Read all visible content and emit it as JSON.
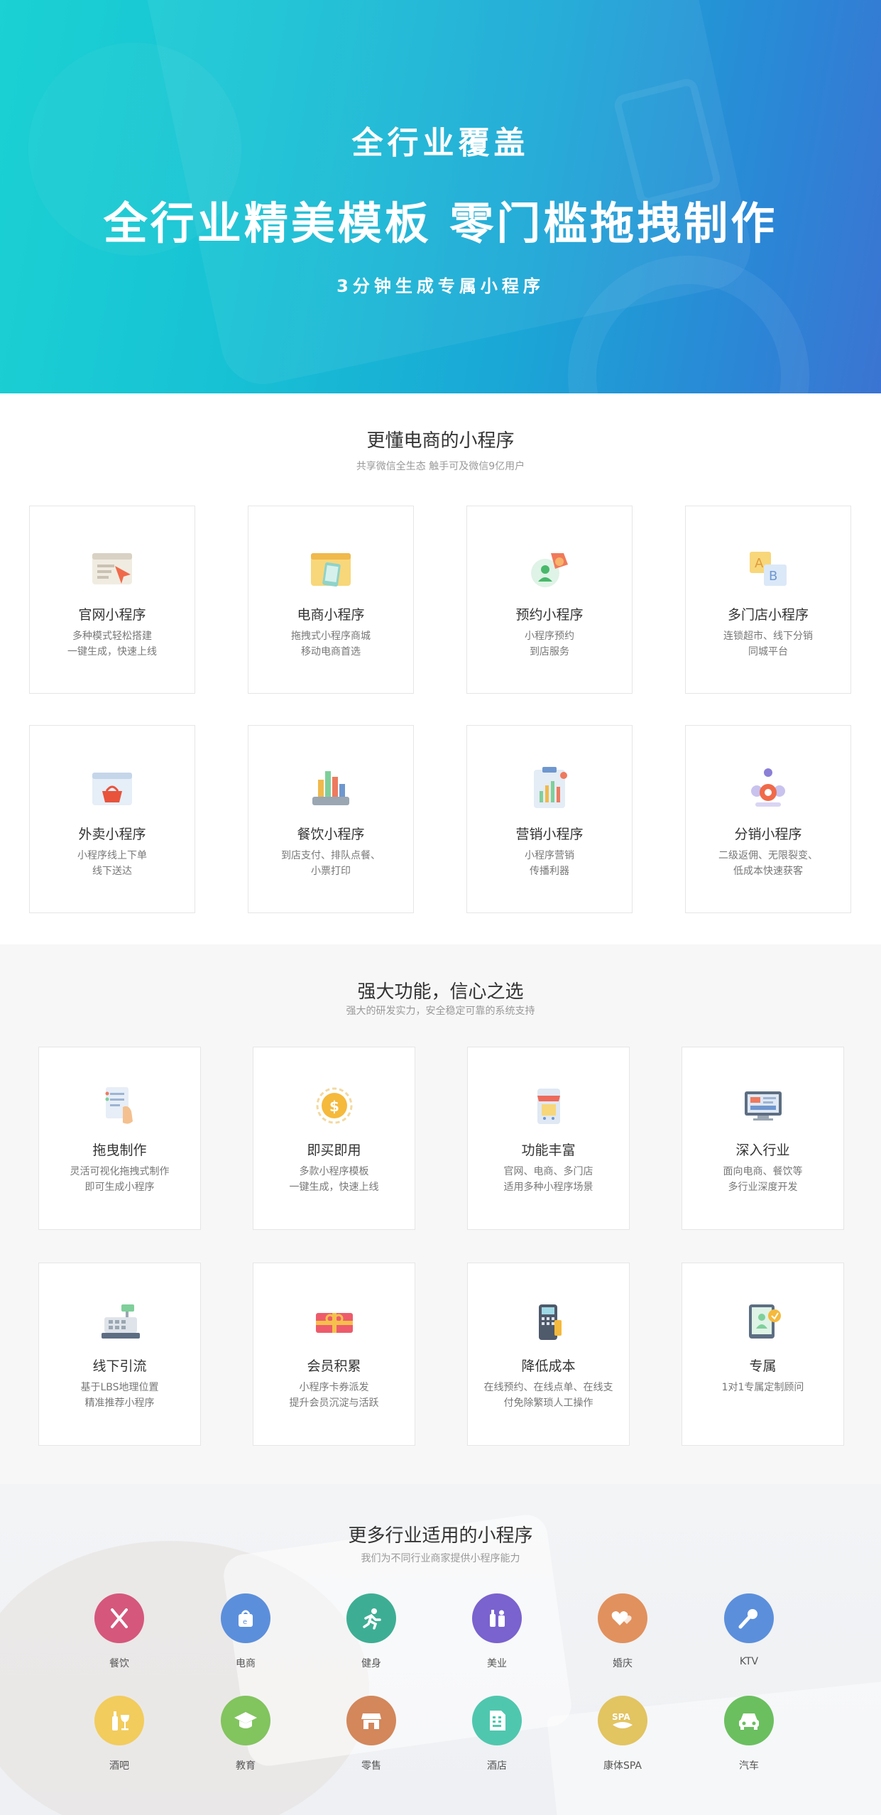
{
  "hero": {
    "subtitle_top": "全行业覆盖",
    "title": "全行业精美模板 零门槛拖拽制作",
    "subtitle_bottom": "3分钟生成专属小程序"
  },
  "section1": {
    "title": "更懂电商的小程序",
    "subtitle": "共享微信全生态 触手可及微信9亿用户",
    "cards": [
      {
        "icon": "website-icon",
        "title": "官网小程序",
        "desc": "多种模式轻松搭建\n一键生成，快速上线"
      },
      {
        "icon": "ecommerce-icon",
        "title": "电商小程序",
        "desc": "拖拽式小程序商城\n移动电商首选"
      },
      {
        "icon": "booking-icon",
        "title": "预约小程序",
        "desc": "小程序预约\n到店服务"
      },
      {
        "icon": "multi-store-icon",
        "title": "多门店小程序",
        "desc": "连锁超市、线下分销\n同城平台"
      },
      {
        "icon": "takeaway-icon",
        "title": "外卖小程序",
        "desc": "小程序线上下单\n线下送达"
      },
      {
        "icon": "catering-icon",
        "title": "餐饮小程序",
        "desc": "到店支付、排队点餐、\n小票打印"
      },
      {
        "icon": "marketing-icon",
        "title": "营销小程序",
        "desc": "小程序营销\n传播利器"
      },
      {
        "icon": "distribution-icon",
        "title": "分销小程序",
        "desc": "二级返佣、无限裂变、\n低成本快速获客"
      }
    ]
  },
  "section2": {
    "title": "强大功能，信心之选",
    "subtitle": "强大的研发实力，安全稳定可靠的系统支持",
    "cards": [
      {
        "icon": "drag-build-icon",
        "title": "拖曳制作",
        "desc": "灵活可视化拖拽式制作\n即可生成小程序"
      },
      {
        "icon": "coin-icon",
        "title": "即买即用",
        "desc": "多款小程序模板\n一键生成，快速上线"
      },
      {
        "icon": "shop-phone-icon",
        "title": "功能丰富",
        "desc": "官网、电商、多门店\n适用多种小程序场景"
      },
      {
        "icon": "monitor-icon",
        "title": "深入行业",
        "desc": "面向电商、餐饮等\n多行业深度开发"
      },
      {
        "icon": "cash-register-icon",
        "title": "线下引流",
        "desc": "基于LBS地理位置\n精准推荐小程序"
      },
      {
        "icon": "gift-card-icon",
        "title": "会员积累",
        "desc": "小程序卡券派发\n提升会员沉淀与活跃"
      },
      {
        "icon": "pos-terminal-icon",
        "title": "降低成本",
        "desc": "在线预约、在线点单、在线支\n付免除繁琐人工操作"
      },
      {
        "icon": "consultant-icon",
        "title": "专属",
        "desc": "1对1专属定制顾问"
      }
    ]
  },
  "section3": {
    "title": "更多行业适用的小程序",
    "subtitle": "我们为不同行业商家提供小程序能力",
    "industries": [
      {
        "icon": "fork-knife-icon",
        "label": "餐饮",
        "color": "#d5577c"
      },
      {
        "icon": "shopping-bag-icon",
        "label": "电商",
        "color": "#5b8fdc"
      },
      {
        "icon": "running-icon",
        "label": "健身",
        "color": "#3dae94"
      },
      {
        "icon": "cosmetics-icon",
        "label": "美业",
        "color": "#7a62cf"
      },
      {
        "icon": "hearts-icon",
        "label": "婚庆",
        "color": "#e1915d"
      },
      {
        "icon": "microphone-icon",
        "label": "KTV",
        "color": "#5b8fdc"
      },
      {
        "icon": "wine-icon",
        "label": "酒吧",
        "color": "#f2cc5c"
      },
      {
        "icon": "graduation-cap-icon",
        "label": "教育",
        "color": "#82c45e"
      },
      {
        "icon": "store-icon",
        "label": "零售",
        "color": "#d3875b"
      },
      {
        "icon": "hotel-icon",
        "label": "酒店",
        "color": "#4fc7ae"
      },
      {
        "icon": "spa-icon",
        "label": "康体SPA",
        "color": "#e2c461"
      },
      {
        "icon": "car-icon",
        "label": "汽车",
        "color": "#6bbf5f"
      }
    ]
  }
}
